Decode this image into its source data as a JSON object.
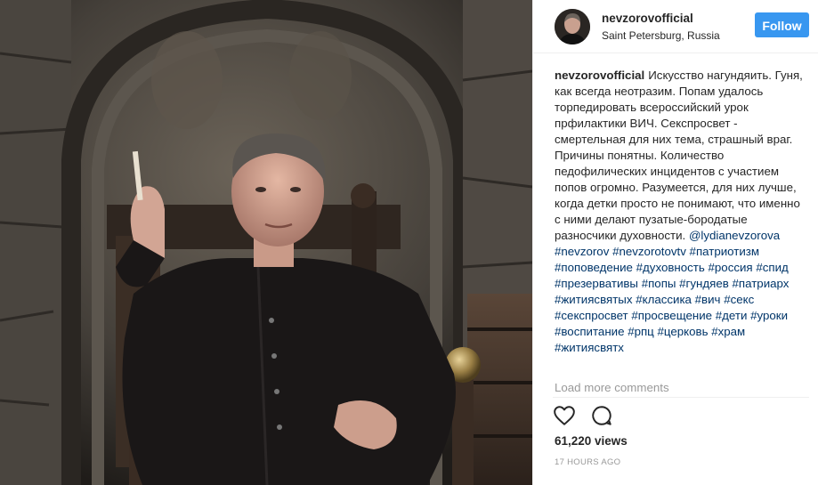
{
  "post": {
    "username": "nevzorovofficial",
    "location": "Saint Petersburg, Russia",
    "follow_label": "Follow",
    "caption_author": "nevzorovofficial",
    "caption_text": "Искусство нагундяить. Гуня, как всегда неотразим. Попам удалось торпедировать всероссийский урок прфилактики ВИЧ. Секспросвет - смертельная для них тема, страшный враг. Причины понятны. Количество педофилических инцидентов с участием попов огромно. Разумеется, для них лучше, когда детки просто не понимают, что именно с ними делают пузатые-бородатые разносчики духовности.",
    "mentions": [
      "@lydianevzorova",
      "#nevzorov",
      "#nevzorotovtv"
    ],
    "hashtags": [
      "#патриотизм",
      "#поповедение",
      "#духовность",
      "#россия",
      "#спид",
      "#презервативы",
      "#попы",
      "#гундяев",
      "#патриарх",
      "#житиясвятых",
      "#классика",
      "#вич",
      "#секс",
      "#секспросвет",
      "#просвещение",
      "#дети",
      "#уроки",
      "#воспитание",
      "#рпц",
      "#церковь",
      "#храм",
      "#житиясвятх"
    ],
    "load_more_label": "Load more comments",
    "views": "61,220 views",
    "timestamp": "17 HOURS AGO"
  },
  "icons": {
    "like": "heart-icon",
    "comment": "comment-icon"
  },
  "colors": {
    "follow_bg": "#3897f0",
    "link": "#003569",
    "muted": "#999999",
    "border": "#efefef"
  }
}
